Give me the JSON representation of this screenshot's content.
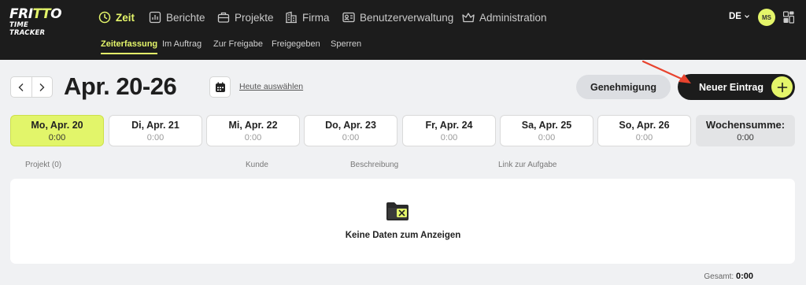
{
  "logo": {
    "line1_a": "FRI",
    "line1_b": "TT",
    "line1_c": "O",
    "line2": "TIME TRACKER"
  },
  "nav": {
    "items": [
      {
        "label": "Zeit",
        "icon": "clock-icon"
      },
      {
        "label": "Berichte",
        "icon": "chart-icon"
      },
      {
        "label": "Projekte",
        "icon": "briefcase-icon"
      },
      {
        "label": "Firma",
        "icon": "building-icon"
      },
      {
        "label": "Benutzerverwaltung",
        "icon": "id-card-icon"
      },
      {
        "label": "Administration",
        "icon": "crown-icon"
      }
    ],
    "sub": [
      "Zeiterfassung",
      "Im Auftrag",
      "Zur Freigabe",
      "Freigegeben",
      "Sperren"
    ],
    "lang": "DE",
    "avatar": "MS"
  },
  "week": {
    "title": "Apr. 20-26",
    "today_link": "Heute auswählen",
    "approve_label": "Genehmigung",
    "new_label": "Neuer Eintrag"
  },
  "days": [
    {
      "name": "Mo, Apr. 20",
      "time": "0:00"
    },
    {
      "name": "Di, Apr. 21",
      "time": "0:00"
    },
    {
      "name": "Mi, Apr. 22",
      "time": "0:00"
    },
    {
      "name": "Do, Apr. 23",
      "time": "0:00"
    },
    {
      "name": "Fr, Apr. 24",
      "time": "0:00"
    },
    {
      "name": "Sa, Apr. 25",
      "time": "0:00"
    },
    {
      "name": "So, Apr. 26",
      "time": "0:00"
    }
  ],
  "weeksum": {
    "label": "Wochensumme:",
    "time": "0:00"
  },
  "table": {
    "columns": [
      "Projekt (0)",
      "Kunde",
      "Beschreibung",
      "Link zur Aufgabe"
    ],
    "empty_text": "Keine Daten zum Anzeigen"
  },
  "total": {
    "label": "Gesamt:",
    "value": "0:00"
  },
  "colors": {
    "accent": "#e4f56a",
    "nav_bg": "#1c1c1c",
    "annotation_arrow": "#e8432e"
  }
}
